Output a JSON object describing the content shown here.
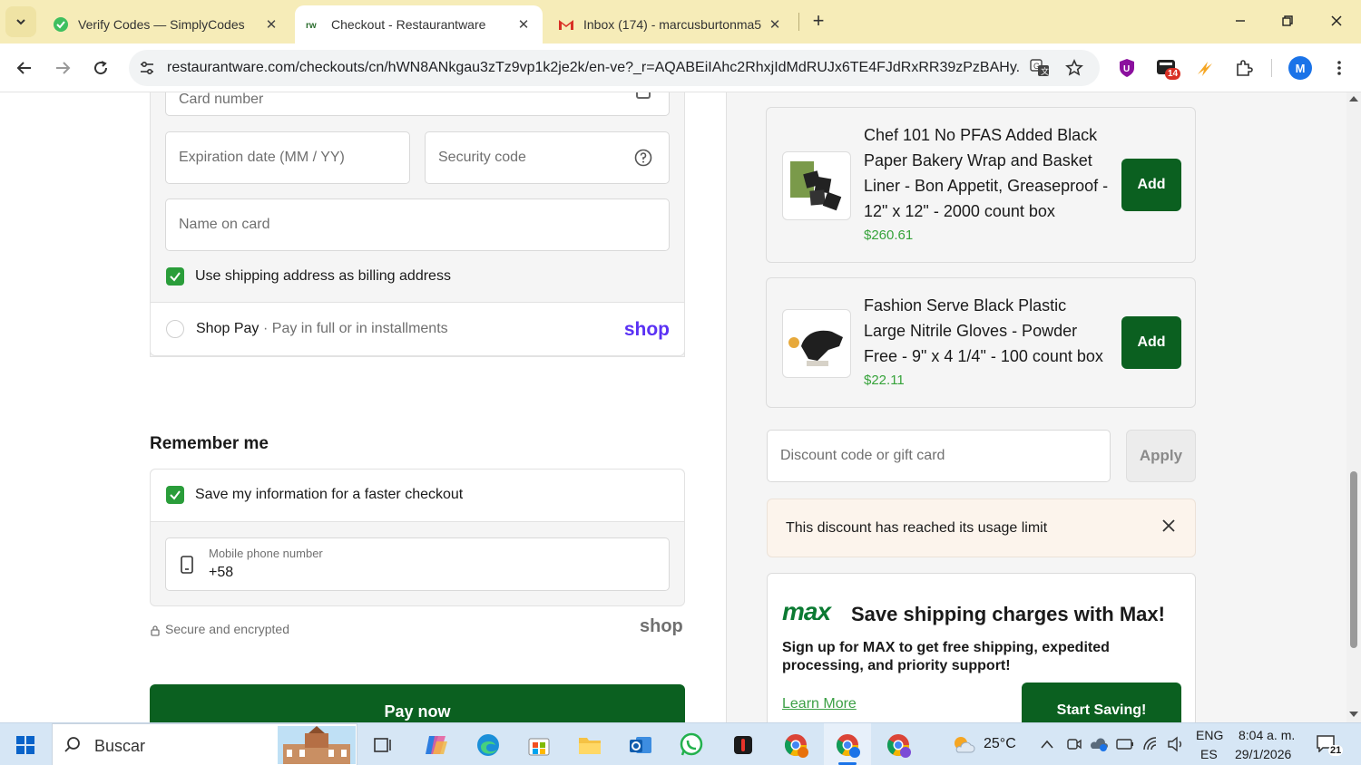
{
  "browser": {
    "tabs": [
      {
        "title": "Verify Codes — SimplyCodes",
        "active": false
      },
      {
        "title": "Checkout - Restaurantware",
        "active": true
      },
      {
        "title": "Inbox (174) - marcusburtonma5",
        "active": false
      }
    ],
    "url": "restaurantware.com/checkouts/cn/hWN8ANkgau3zTz9vp1k2je2k/en-ve?_r=AQABEiIAhc2RhxjIdMdRUJx6TE4FJdRxRR39zPzBAHy...",
    "extension_badge": "14",
    "profile_initial": "M"
  },
  "payment": {
    "card_number_placeholder": "Card number",
    "expiration_placeholder": "Expiration date (MM / YY)",
    "security_placeholder": "Security code",
    "name_placeholder": "Name on card",
    "use_shipping_label": "Use shipping address as billing address",
    "shop_pay_label": "Shop Pay",
    "shop_pay_sub": "· Pay in full or in installments",
    "shop_logo": "shop"
  },
  "remember": {
    "heading": "Remember me",
    "save_label": "Save my information for a faster checkout",
    "phone_label": "Mobile phone number",
    "phone_value": "+58",
    "secure_label": "Secure and encrypted",
    "shop_logo": "shop"
  },
  "pay_button": "Pay now",
  "products": [
    {
      "name": "Chef 101 No PFAS Added Black Paper Bakery Wrap and Basket Liner - Bon Appetit, Greaseproof - 12\" x 12\" - 2000 count box",
      "price": "$260.61",
      "add_label": "Add"
    },
    {
      "name": "Fashion Serve Black Plastic Large Nitrile Gloves - Powder Free - 9\" x 4 1/4\" - 100 count box",
      "price": "$22.11",
      "add_label": "Add"
    }
  ],
  "discount": {
    "placeholder": "Discount code or gift card",
    "apply_label": "Apply",
    "error": "This discount has reached its usage limit"
  },
  "max": {
    "logo": "max",
    "headline": "Save shipping charges with Max!",
    "body": "Sign up for MAX to get free shipping, expedited processing, and priority support!",
    "learn_more": "Learn More",
    "cta": "Start Saving!"
  },
  "taskbar": {
    "search_placeholder": "Buscar",
    "weather": "25°C",
    "lang_top": "ENG",
    "lang_bottom": "ES",
    "time": "8:04 a. m.",
    "date": "29/1/2026",
    "notifications": "21"
  },
  "colors": {
    "brand_green": "#0b6020",
    "price_green": "#37a33b",
    "shop_purple": "#5a31f4",
    "tab_bar": "#f6ecb8"
  }
}
